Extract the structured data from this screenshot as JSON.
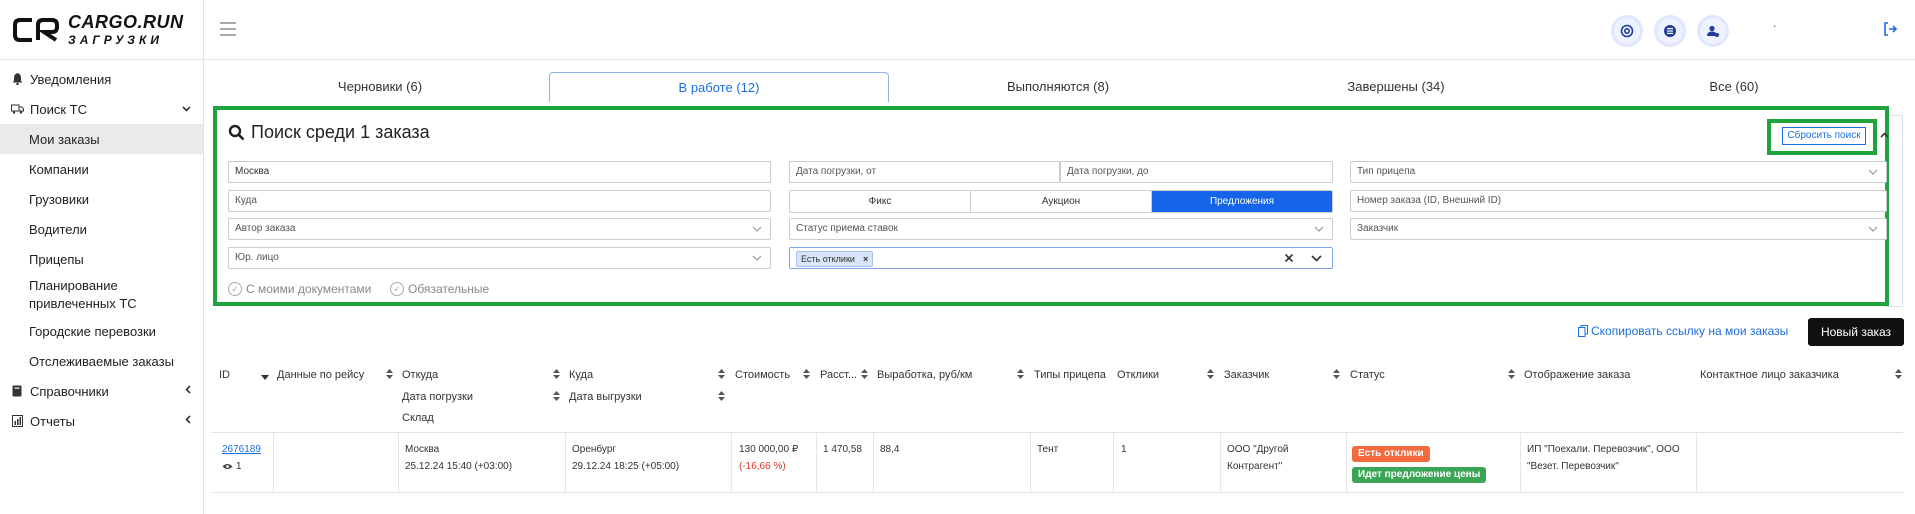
{
  "logo": {
    "title": "CARGO.RUN",
    "subtitle": "ЗАГРУЗКИ"
  },
  "sidebar": {
    "items": [
      {
        "label": "Уведомления",
        "icon": "bell-icon"
      },
      {
        "label": "Поиск ТС",
        "icon": "truck-icon"
      },
      {
        "label": "Мои заказы"
      },
      {
        "label": "Компании"
      },
      {
        "label": "Грузовики"
      },
      {
        "label": "Водители"
      },
      {
        "label": "Прицепы"
      },
      {
        "label": "Планирование привлеченных ТС"
      },
      {
        "label": "Городские перевозки"
      },
      {
        "label": "Отслеживаемые заказы"
      },
      {
        "label": "Справочники",
        "icon": "book-icon"
      },
      {
        "label": "Отчеты",
        "icon": "report-icon"
      }
    ]
  },
  "topbar": {
    "user_dot": "."
  },
  "tabs": [
    {
      "label": "Черновики (6)"
    },
    {
      "label": "В работе (12)"
    },
    {
      "label": "Выполняются (8)"
    },
    {
      "label": "Завершены (34)"
    },
    {
      "label": "Все (60)"
    }
  ],
  "search": {
    "title": "Поиск среди 1 заказа",
    "reset": "Сбросить поиск",
    "from_value": "Москва",
    "to_placeholder": "Куда",
    "author_placeholder": "Автор заказа",
    "legal_placeholder": "Юр. лицо",
    "date_from_placeholder": "Дата погрузки, от",
    "date_to_placeholder": "Дата погрузки, до",
    "mode_options": [
      "Фикс",
      "Аукцион",
      "Предложения"
    ],
    "mode_selected": "Предложения",
    "bid_status_placeholder": "Статус приема ставок",
    "tag_value": "Есть отклики",
    "trailer_placeholder": "Тип прицепа",
    "order_number_placeholder": "Номер заказа (ID, Внешний ID)",
    "customer_placeholder": "Заказчик",
    "checkbox_docs": "С моими документами",
    "checkbox_required": "Обязательные"
  },
  "actions": {
    "copy_link": "Скопировать ссылку на мои заказы",
    "new_order": "Новый заказ"
  },
  "table": {
    "headers": {
      "id": "ID",
      "route_data": "Данные по рейсу",
      "from": "Откуда",
      "load_date": "Дата погрузки",
      "warehouse": "Склад",
      "to": "Куда",
      "unload_date": "Дата выгрузки",
      "cost": "Стоимость",
      "distance": "Расст...",
      "output": "Выработка, руб/км",
      "trailer": "Типы прицепа",
      "responses": "Отклики",
      "customer": "Заказчик",
      "status": "Статус",
      "display": "Отображение заказа",
      "contact": "Контактное лицо заказчика"
    },
    "rows": [
      {
        "id": "2676189",
        "views": "1",
        "from": "Москва",
        "load_date": "25.12.24 15:40 (+03:00)",
        "to": "Оренбург",
        "unload_date": "29.12.24 18:25 (+05:00)",
        "cost": "130 000,00 ₽",
        "cost_delta": "(-16,66 %)",
        "distance": "1 470,58",
        "output": "88,4",
        "trailer": "Тент",
        "responses": "1",
        "customer_line1": "ООО \"Другой",
        "customer_line2": "Контрагент\"",
        "status1": "Есть отклики",
        "status2": "Идет предложение цены",
        "display_line1": "ИП \"Поехали. Перевозчик\", ООО",
        "display_line2": "\"Везет. Перевозчик\""
      }
    ]
  },
  "colors": {
    "accent": "#1a6fe0",
    "highlight": "#1fa33c",
    "badge_orange": "#f26a3d",
    "badge_green": "#3aa655"
  }
}
